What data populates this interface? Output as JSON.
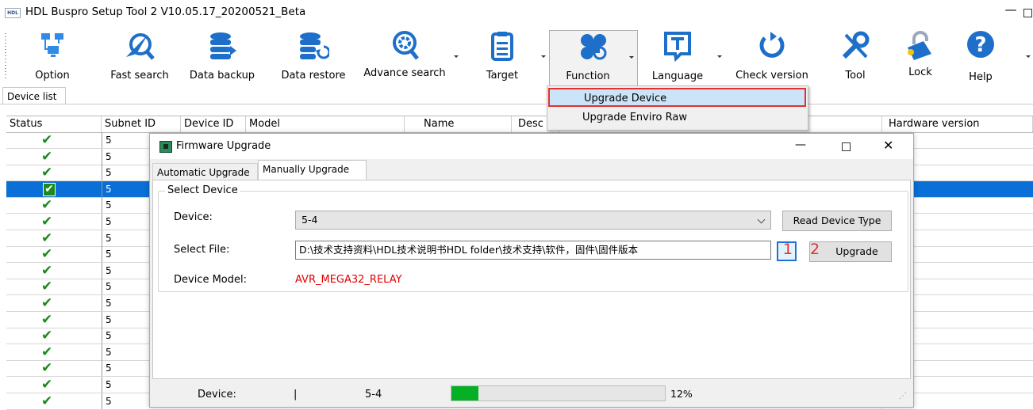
{
  "window": {
    "title": "HDL Buspro Setup Tool 2 V10.05.17_20200521_Beta",
    "logo_text": "HDL",
    "minimize_glyph": "—"
  },
  "toolbar": {
    "items": [
      {
        "label": "Option",
        "icon": "network-icon"
      },
      {
        "label": "Fast search",
        "icon": "paper-plane-search-icon"
      },
      {
        "label": "Data backup",
        "icon": "database-icon"
      },
      {
        "label": "Data restore",
        "icon": "database-restore-icon"
      },
      {
        "label": "Advance search",
        "icon": "gear-search-icon"
      },
      {
        "label": "Target",
        "icon": "clipboard-icon"
      },
      {
        "label": "Function",
        "icon": "clover-icon"
      },
      {
        "label": "Language",
        "icon": "text-t-icon"
      },
      {
        "label": "Check version",
        "icon": "refresh-icon"
      },
      {
        "label": "Tool",
        "icon": "wrench-screwdriver-icon"
      },
      {
        "label": "Lock",
        "icon": "lock-icon"
      },
      {
        "label": "Help",
        "icon": "help-icon"
      }
    ]
  },
  "device_list_tab": "Device list",
  "grid": {
    "columns": [
      "Status",
      "Subnet ID",
      "Device ID",
      "Model",
      "Name",
      "Desc",
      "Hardware version"
    ],
    "rows": [
      {
        "subnet": "5"
      },
      {
        "subnet": "5"
      },
      {
        "subnet": "5"
      },
      {
        "subnet": "5"
      },
      {
        "subnet": "5"
      },
      {
        "subnet": "5"
      },
      {
        "subnet": "5"
      },
      {
        "subnet": "5"
      },
      {
        "subnet": "5"
      },
      {
        "subnet": "5"
      },
      {
        "subnet": "5"
      },
      {
        "subnet": "5"
      },
      {
        "subnet": "5"
      },
      {
        "subnet": "5"
      },
      {
        "subnet": "5"
      },
      {
        "subnet": "5"
      },
      {
        "subnet": "5"
      }
    ],
    "selected_row": 3,
    "status_icon": "✔"
  },
  "function_menu": {
    "items": [
      "Upgrade Device",
      "Upgrade Enviro Raw"
    ],
    "highlighted": "Upgrade Device"
  },
  "dialog": {
    "title": "Firmware Upgrade",
    "tabs": [
      "Automatic Upgrade",
      "Manually Upgrade"
    ],
    "active_tab": "Manually Upgrade",
    "group_title": "Select Device",
    "device_label": "Device:",
    "device_value": "5-4",
    "select_file_label": "Select File:",
    "select_file_value": "D:\\技术支持资料\\HDL技术说明书HDL folder\\技术支持\\软件，固件\\固件版本",
    "read_button": "Read Device Type",
    "browse_button": "..",
    "annotation_1": "1",
    "annotation_2": "2",
    "upgrade_button": "Upgrade",
    "model_label": "Device Model:",
    "model_value": "AVR_MEGA32_RELAY",
    "status": {
      "device_label": "Device:",
      "cursor": "|",
      "device_value": "5-4",
      "progress": 0.12,
      "progress_text": "12%"
    }
  },
  "colors": {
    "selection": "#0a6fd6",
    "menu_highlight": "#cce4f7",
    "annotation_red": "#e03131",
    "progress_green": "#06b025",
    "check_green": "#1b8a1b"
  }
}
